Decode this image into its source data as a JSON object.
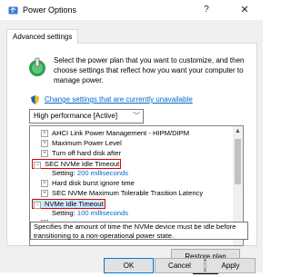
{
  "window": {
    "title": "Power Options",
    "help_glyph": "?",
    "close_glyph": "✕"
  },
  "tab": {
    "label": "Advanced settings"
  },
  "intro": {
    "text": "Select the power plan that you want to customize, and then choose settings that reflect how you want your computer to manage power.",
    "change_link": "Change settings that are currently unavailable"
  },
  "plan_select": {
    "value": "High performance [Active]"
  },
  "tree": {
    "rows": [
      {
        "name": "ahci-link-power-management",
        "label": "AHCI Link Power Management - HIPM/DIPM",
        "expander": "+"
      },
      {
        "name": "maximum-power-level",
        "label": "Maximum Power Level",
        "expander": "+"
      },
      {
        "name": "turn-off-hard-disk-after",
        "label": "Turn off hard disk after",
        "expander": "+"
      },
      {
        "name": "sec-nvme-idle-timeout",
        "label": "SEC NVMe Idle Timeout",
        "expander": "−"
      },
      {
        "name": "sec-nvme-idle-timeout-setting",
        "label": "Setting:",
        "value": "200 milliseconds"
      },
      {
        "name": "hard-disk-burst-ignore-time",
        "label": "Hard disk burst ignore time",
        "expander": "+"
      },
      {
        "name": "sec-nvme-max-tolerable-transition-latency",
        "label": "SEC NVMe Maximum Tolerable Trasition Latency",
        "expander": "+"
      },
      {
        "name": "nvme-idle-timeout",
        "label": "NVMe Idle Timeout",
        "expander": "−"
      },
      {
        "name": "nvme-idle-timeout-setting",
        "label": "Setting:",
        "value": "100 milliseconds"
      }
    ]
  },
  "tooltip": {
    "text": "Specifies the amount of time the NVMe device must be idle before transitioning to a non-operational power state."
  },
  "restore_button": {
    "label": "Restore plan defaults"
  },
  "buttons": {
    "ok": "OK",
    "cancel": "Cancel",
    "apply": "Apply"
  },
  "colors": {
    "link": "#0066cc",
    "highlight_border": "#e00000",
    "selection": "#cde8ff"
  }
}
